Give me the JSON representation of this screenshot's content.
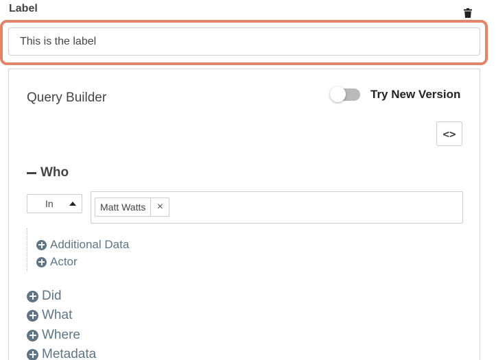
{
  "field": {
    "label": "Label",
    "input_value": "This is the label",
    "highlight_color": "#e08569"
  },
  "query_builder": {
    "title": "Query Builder",
    "toggle": {
      "label": "Try New Version",
      "checked": false
    },
    "code_button_label": "<>",
    "who": {
      "label": "Who",
      "expanded": true,
      "operator": "In",
      "tags": [
        "Matt Watts"
      ],
      "tag_remove_label": "×",
      "children": [
        {
          "label": "Additional Data"
        },
        {
          "label": "Actor"
        }
      ]
    },
    "sections": [
      {
        "label": "Did"
      },
      {
        "label": "What"
      },
      {
        "label": "Where"
      },
      {
        "label": "Metadata"
      }
    ]
  },
  "colors": {
    "accent_border": "#e08569",
    "plus_icon": "#5f7583",
    "toggle_off": "#b9b9b9"
  },
  "icons": {
    "delete": "trash-icon",
    "collapse": "minus-icon",
    "dropdown": "caret-up-icon",
    "add": "plus-circle-icon",
    "code": "code-brackets-icon",
    "remove_tag": "close-icon"
  }
}
